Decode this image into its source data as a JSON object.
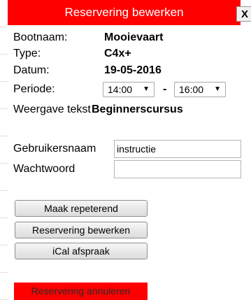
{
  "dialog": {
    "title": "Reservering bewerken",
    "close_label": "X"
  },
  "details": {
    "boat_name_label": "Bootnaam:",
    "boat_name_value": "Mooievaart",
    "type_label": "Type:",
    "type_value": "C4x+",
    "date_label": "Datum:",
    "date_value": "19-05-2016",
    "period_label": "Periode:",
    "period_start": "14:00",
    "period_separator": "-",
    "period_end": "16:00",
    "display_text_label": "Weergave tekst",
    "display_text_value": "Beginnerscursus"
  },
  "login": {
    "username_label": "Gebruikersnaam",
    "username_value": "instructie",
    "password_label": "Wachtwoord",
    "password_value": ""
  },
  "actions": {
    "repeat_label": "Maak repeterend",
    "edit_label": "Reservering bewerken",
    "ical_label": "iCal afspraak",
    "cancel_label": "Reservering annuleren"
  },
  "colors": {
    "header_bg": "#ff0000",
    "header_text": "#ffffff",
    "danger_bg": "#ff0000"
  }
}
